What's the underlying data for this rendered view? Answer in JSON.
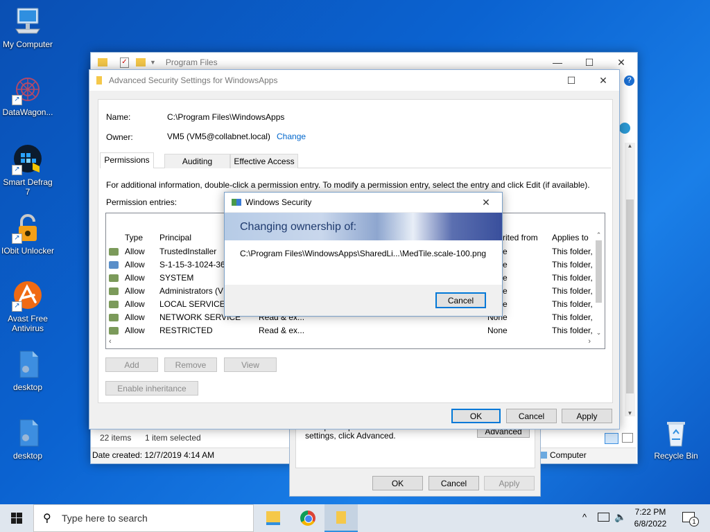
{
  "desktop": {
    "icons": [
      {
        "label": "My Computer"
      },
      {
        "label": "DataWagon..."
      },
      {
        "label": "Smart Defrag 7"
      },
      {
        "label": "IObit Unlocker"
      },
      {
        "label": "Avast Free Antivirus"
      },
      {
        "label": "desktop"
      },
      {
        "label": "desktop"
      },
      {
        "label": "Recycle Bin"
      }
    ]
  },
  "explorer": {
    "title": "Program Files",
    "status_items": "22 items",
    "status_selected": "1 item selected",
    "details": "Date created: 12/7/2019 4:14 AM",
    "computer_label": "Computer"
  },
  "properties": {
    "info_text": "For special permissions or advanced settings, click Advanced.",
    "advanced_label": "Advanced",
    "ok_label": "OK",
    "cancel_label": "Cancel",
    "apply_label": "Apply"
  },
  "advanced": {
    "title": "Advanced Security Settings for WindowsApps",
    "name_label": "Name:",
    "name_value": "C:\\Program Files\\WindowsApps",
    "owner_label": "Owner:",
    "owner_value": "VM5 (VM5@collabnet.local)",
    "change_link": "Change",
    "tabs": [
      "Permissions",
      "Auditing",
      "Effective Access"
    ],
    "info_text": "For additional information, double-click a permission entry. To modify a permission entry, select the entry and click Edit (if available).",
    "entries_label": "Permission entries:",
    "columns": {
      "type": "Type",
      "principal": "Principal",
      "inherited": "rited from",
      "applies": "Applies to"
    },
    "rows": [
      {
        "type": "Allow",
        "principal": "TrustedInstaller",
        "access": "",
        "inherited": "e",
        "applies": "This folder,"
      },
      {
        "type": "Allow",
        "principal": "S-1-15-3-1024-363",
        "access": "",
        "inherited": "e",
        "applies": "This folder,"
      },
      {
        "type": "Allow",
        "principal": "SYSTEM",
        "access": "",
        "inherited": "e",
        "applies": "This folder,"
      },
      {
        "type": "Allow",
        "principal": "Administrators (VM",
        "access": "",
        "inherited": "e",
        "applies": "This folder,"
      },
      {
        "type": "Allow",
        "principal": "LOCAL SERVICE",
        "access": "",
        "inherited": "e",
        "applies": "This folder,"
      },
      {
        "type": "Allow",
        "principal": "NETWORK SERVICE",
        "access": "Read & ex...",
        "inherited": "None",
        "applies": "This folder,"
      },
      {
        "type": "Allow",
        "principal": "RESTRICTED",
        "access": "Read & ex...",
        "inherited": "None",
        "applies": "This folder,"
      }
    ],
    "add_label": "Add",
    "remove_label": "Remove",
    "view_label": "View",
    "enable_inheritance_label": "Enable inheritance",
    "ok_label": "OK",
    "cancel_label": "Cancel",
    "apply_label": "Apply"
  },
  "security_dialog": {
    "title": "Windows Security",
    "banner": "Changing ownership of:",
    "path": "C:\\Program Files\\WindowsApps\\SharedLi...\\MedTile.scale-100.png",
    "cancel_label": "Cancel"
  },
  "taskbar": {
    "search_placeholder": "Type here to search",
    "time": "7:22 PM",
    "date": "6/8/2022",
    "notification_count": "1"
  }
}
